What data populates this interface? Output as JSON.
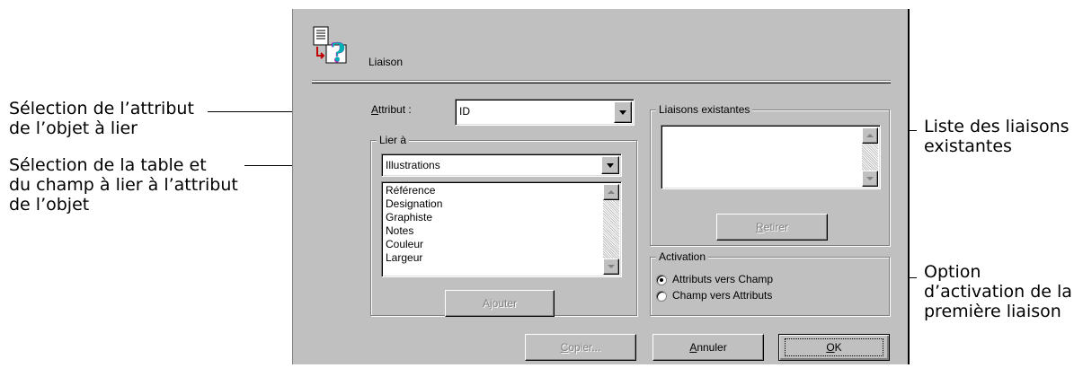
{
  "callouts": {
    "attribut": [
      "Sélection de l’attribut",
      "de l’objet à lier"
    ],
    "table": [
      "Sélection de la table et",
      "du champ à lier à l’attribut",
      "de l’objet"
    ],
    "liste": [
      "Liste des liaisons",
      "existantes"
    ],
    "option": [
      "Option",
      "d’activation de la",
      "première liaison"
    ]
  },
  "dialog": {
    "title": "Liaison",
    "icon": "link-help-icon",
    "attribut": {
      "label_accel": "A",
      "label_rest": "ttribut :",
      "value": "ID"
    },
    "lier_a": {
      "legend": "Lier à",
      "table_value": "Illustrations",
      "fields": [
        "Référence",
        "Designation",
        "Graphiste",
        "Notes",
        "Couleur",
        "Largeur"
      ],
      "add_button": "Ajouter"
    },
    "liaisons": {
      "legend": "Liaisons existantes",
      "items": [],
      "remove_accel": "R",
      "remove_rest": "etirer"
    },
    "activation": {
      "legend": "Activation",
      "options": [
        "Attributs vers Champ",
        "Champ vers Attributs"
      ],
      "selected": 0
    },
    "buttons": {
      "copy_accel": "C",
      "copy_rest": "opier...",
      "cancel_accel": "A",
      "cancel_rest": "nnuler",
      "ok_accel": "O",
      "ok_rest": "K"
    }
  }
}
